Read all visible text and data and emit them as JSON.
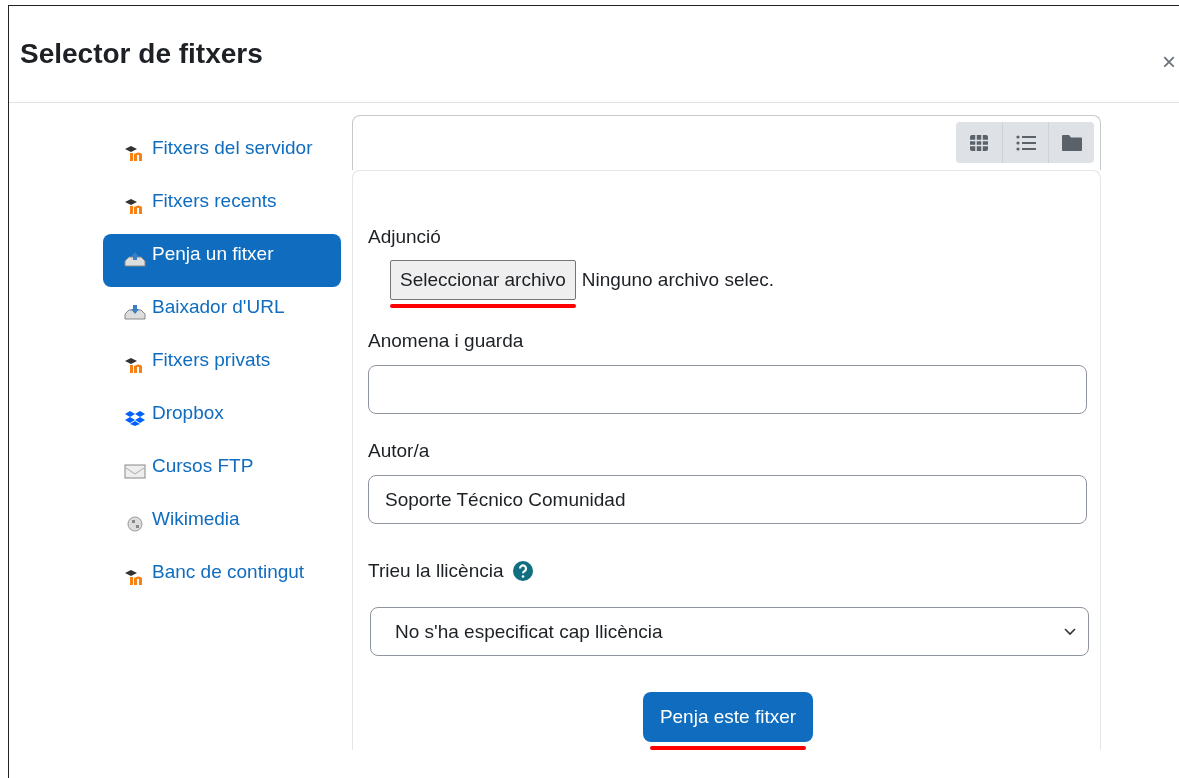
{
  "window": {
    "title": "Selector de fitxers",
    "close": "×"
  },
  "sidebar": {
    "items": [
      {
        "label": "Fitxers del servidor",
        "kind": "moodle",
        "selected": false
      },
      {
        "label": "Fitxers recents",
        "kind": "moodle",
        "selected": false
      },
      {
        "label": "Penja un fitxer",
        "kind": "upload",
        "selected": true
      },
      {
        "label": "Baixador d'URL",
        "kind": "download",
        "selected": false
      },
      {
        "label": "Fitxers privats",
        "kind": "moodle",
        "selected": false
      },
      {
        "label": "Dropbox",
        "kind": "dropbox",
        "selected": false
      },
      {
        "label": "Cursos FTP",
        "kind": "ftp",
        "selected": false
      },
      {
        "label": "Wikimedia",
        "kind": "wiki",
        "selected": false
      },
      {
        "label": "Banc de contingut",
        "kind": "moodle",
        "selected": false
      }
    ]
  },
  "view_buttons": [
    {
      "kind": "grid"
    },
    {
      "kind": "list"
    },
    {
      "kind": "folder"
    }
  ],
  "form": {
    "attachment": {
      "label": "Adjunció",
      "button": "Seleccionar archivo",
      "status": "Ninguno archivo selec.",
      "underlined": true
    },
    "save_as": {
      "label": "Anomena i guarda"
    },
    "author": {
      "label": "Autor/a",
      "value": "Soporte Técnico Comunidad"
    },
    "license": {
      "label": "Trieu la llicència",
      "help": true,
      "value": "No s'ha especificat cap llicència"
    },
    "submit": {
      "label": "Penja este fitxer",
      "underlined": true
    }
  }
}
